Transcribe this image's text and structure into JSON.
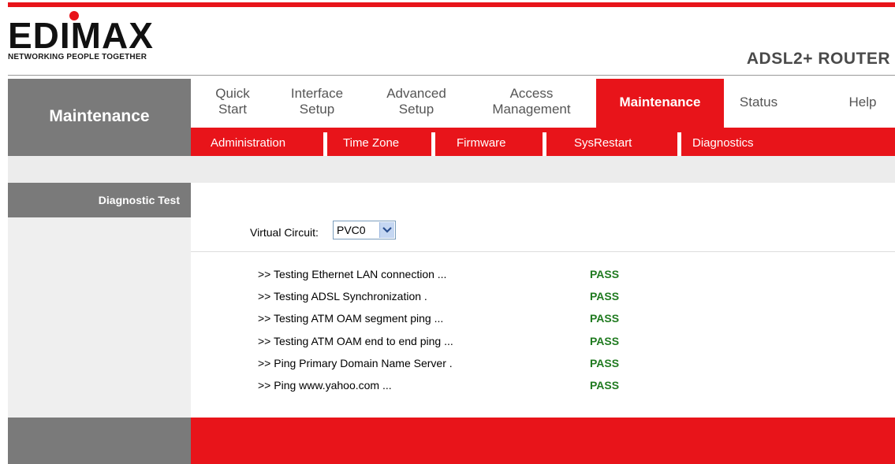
{
  "brand": {
    "logo_text": "EDIMAX",
    "tagline": "NETWORKING PEOPLE TOGETHER",
    "product": "ADSL2+ ROUTER"
  },
  "section_title": "Maintenance",
  "main_menu": [
    {
      "line1": "Quick",
      "line2": "Start"
    },
    {
      "line1": "Interface",
      "line2": "Setup"
    },
    {
      "line1": "Advanced",
      "line2": "Setup"
    },
    {
      "line1": "Access",
      "line2": "Management"
    },
    {
      "label": "Maintenance",
      "active": true
    },
    {
      "label": "Status"
    },
    {
      "label": "Help"
    }
  ],
  "sub_menu": [
    "Administration",
    "Time Zone",
    "Firmware",
    "SysRestart",
    "Diagnostics"
  ],
  "left_label": "Diagnostic Test",
  "virtual_circuit": {
    "label": "Virtual Circuit:",
    "value": "PVC0"
  },
  "tests": [
    {
      "name": ">> Testing Ethernet LAN connection ...",
      "result": "PASS"
    },
    {
      "name": ">> Testing ADSL Synchronization .",
      "result": "PASS"
    },
    {
      "name": ">> Testing ATM OAM segment ping ...",
      "result": "PASS"
    },
    {
      "name": ">> Testing ATM OAM end to end ping ...",
      "result": "PASS"
    },
    {
      "name": ">> Ping Primary Domain Name Server .",
      "result": "PASS"
    },
    {
      "name": ">> Ping www.yahoo.com ...",
      "result": "PASS"
    }
  ],
  "colors": {
    "accent": "#e8141a",
    "gray": "#7a7a7a",
    "pass": "#1f7a1f"
  }
}
